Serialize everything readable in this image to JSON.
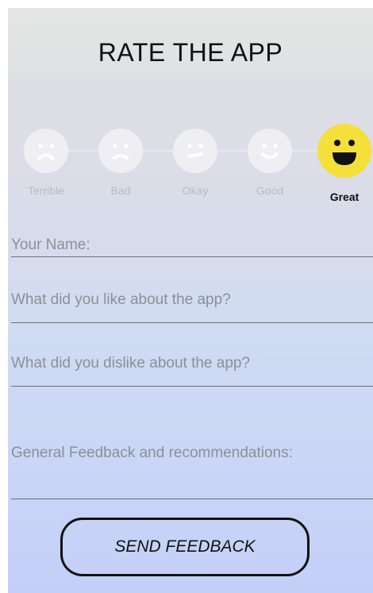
{
  "header": {
    "title": "RATE THE APP"
  },
  "rating": {
    "options": [
      {
        "label": "Terrible",
        "icon": "very-sad-face-icon"
      },
      {
        "label": "Bad",
        "icon": "sad-face-icon"
      },
      {
        "label": "Okay",
        "icon": "neutral-face-icon"
      },
      {
        "label": "Good",
        "icon": "smile-face-icon"
      },
      {
        "label": "Great",
        "icon": "laughing-face-icon"
      }
    ],
    "selected": "Great",
    "selected_color": "#f5df3b"
  },
  "form": {
    "name_label": "Your Name:",
    "like_label": "What did you like about the app?",
    "dislike_label": "What did you dislike about the app?",
    "general_label": "General Feedback and recommendations:"
  },
  "actions": {
    "send_label": "SEND FEEDBACK"
  }
}
